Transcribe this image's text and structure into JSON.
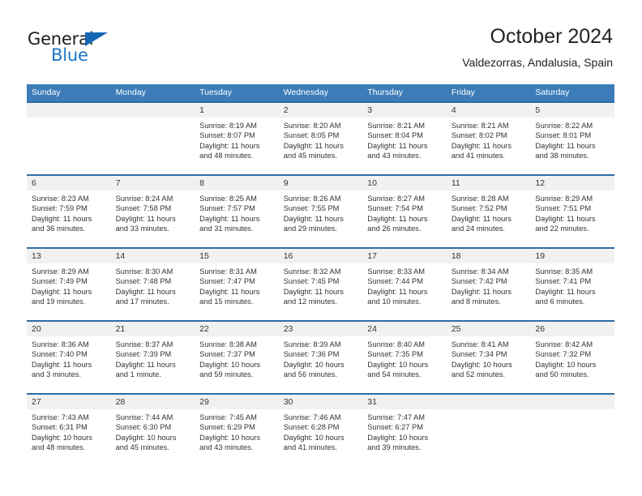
{
  "brand": {
    "name_part1": "General",
    "name_part2": "Blue",
    "triangle_color": "#1567b2",
    "blue_color": "#1b76c4"
  },
  "header": {
    "title": "October 2024",
    "subtitle": "Valdezorras, Andalusia, Spain"
  },
  "theme": {
    "header_bg": "#3c7cb8",
    "row_rule": "#2e6da4",
    "daynum_bg": "#f1f1f1"
  },
  "weekdays": [
    "Sunday",
    "Monday",
    "Tuesday",
    "Wednesday",
    "Thursday",
    "Friday",
    "Saturday"
  ],
  "weeks": [
    [
      {
        "day": "",
        "sunrise": "",
        "sunset": "",
        "daylight_line1": "",
        "daylight_line2": ""
      },
      {
        "day": "",
        "sunrise": "",
        "sunset": "",
        "daylight_line1": "",
        "daylight_line2": ""
      },
      {
        "day": "1",
        "sunrise": "Sunrise: 8:19 AM",
        "sunset": "Sunset: 8:07 PM",
        "daylight_line1": "Daylight: 11 hours",
        "daylight_line2": "and 48 minutes."
      },
      {
        "day": "2",
        "sunrise": "Sunrise: 8:20 AM",
        "sunset": "Sunset: 8:05 PM",
        "daylight_line1": "Daylight: 11 hours",
        "daylight_line2": "and 45 minutes."
      },
      {
        "day": "3",
        "sunrise": "Sunrise: 8:21 AM",
        "sunset": "Sunset: 8:04 PM",
        "daylight_line1": "Daylight: 11 hours",
        "daylight_line2": "and 43 minutes."
      },
      {
        "day": "4",
        "sunrise": "Sunrise: 8:21 AM",
        "sunset": "Sunset: 8:02 PM",
        "daylight_line1": "Daylight: 11 hours",
        "daylight_line2": "and 41 minutes."
      },
      {
        "day": "5",
        "sunrise": "Sunrise: 8:22 AM",
        "sunset": "Sunset: 8:01 PM",
        "daylight_line1": "Daylight: 11 hours",
        "daylight_line2": "and 38 minutes."
      }
    ],
    [
      {
        "day": "6",
        "sunrise": "Sunrise: 8:23 AM",
        "sunset": "Sunset: 7:59 PM",
        "daylight_line1": "Daylight: 11 hours",
        "daylight_line2": "and 36 minutes."
      },
      {
        "day": "7",
        "sunrise": "Sunrise: 8:24 AM",
        "sunset": "Sunset: 7:58 PM",
        "daylight_line1": "Daylight: 11 hours",
        "daylight_line2": "and 33 minutes."
      },
      {
        "day": "8",
        "sunrise": "Sunrise: 8:25 AM",
        "sunset": "Sunset: 7:57 PM",
        "daylight_line1": "Daylight: 11 hours",
        "daylight_line2": "and 31 minutes."
      },
      {
        "day": "9",
        "sunrise": "Sunrise: 8:26 AM",
        "sunset": "Sunset: 7:55 PM",
        "daylight_line1": "Daylight: 11 hours",
        "daylight_line2": "and 29 minutes."
      },
      {
        "day": "10",
        "sunrise": "Sunrise: 8:27 AM",
        "sunset": "Sunset: 7:54 PM",
        "daylight_line1": "Daylight: 11 hours",
        "daylight_line2": "and 26 minutes."
      },
      {
        "day": "11",
        "sunrise": "Sunrise: 8:28 AM",
        "sunset": "Sunset: 7:52 PM",
        "daylight_line1": "Daylight: 11 hours",
        "daylight_line2": "and 24 minutes."
      },
      {
        "day": "12",
        "sunrise": "Sunrise: 8:29 AM",
        "sunset": "Sunset: 7:51 PM",
        "daylight_line1": "Daylight: 11 hours",
        "daylight_line2": "and 22 minutes."
      }
    ],
    [
      {
        "day": "13",
        "sunrise": "Sunrise: 8:29 AM",
        "sunset": "Sunset: 7:49 PM",
        "daylight_line1": "Daylight: 11 hours",
        "daylight_line2": "and 19 minutes."
      },
      {
        "day": "14",
        "sunrise": "Sunrise: 8:30 AM",
        "sunset": "Sunset: 7:48 PM",
        "daylight_line1": "Daylight: 11 hours",
        "daylight_line2": "and 17 minutes."
      },
      {
        "day": "15",
        "sunrise": "Sunrise: 8:31 AM",
        "sunset": "Sunset: 7:47 PM",
        "daylight_line1": "Daylight: 11 hours",
        "daylight_line2": "and 15 minutes."
      },
      {
        "day": "16",
        "sunrise": "Sunrise: 8:32 AM",
        "sunset": "Sunset: 7:45 PM",
        "daylight_line1": "Daylight: 11 hours",
        "daylight_line2": "and 12 minutes."
      },
      {
        "day": "17",
        "sunrise": "Sunrise: 8:33 AM",
        "sunset": "Sunset: 7:44 PM",
        "daylight_line1": "Daylight: 11 hours",
        "daylight_line2": "and 10 minutes."
      },
      {
        "day": "18",
        "sunrise": "Sunrise: 8:34 AM",
        "sunset": "Sunset: 7:42 PM",
        "daylight_line1": "Daylight: 11 hours",
        "daylight_line2": "and 8 minutes."
      },
      {
        "day": "19",
        "sunrise": "Sunrise: 8:35 AM",
        "sunset": "Sunset: 7:41 PM",
        "daylight_line1": "Daylight: 11 hours",
        "daylight_line2": "and 6 minutes."
      }
    ],
    [
      {
        "day": "20",
        "sunrise": "Sunrise: 8:36 AM",
        "sunset": "Sunset: 7:40 PM",
        "daylight_line1": "Daylight: 11 hours",
        "daylight_line2": "and 3 minutes."
      },
      {
        "day": "21",
        "sunrise": "Sunrise: 8:37 AM",
        "sunset": "Sunset: 7:39 PM",
        "daylight_line1": "Daylight: 11 hours",
        "daylight_line2": "and 1 minute."
      },
      {
        "day": "22",
        "sunrise": "Sunrise: 8:38 AM",
        "sunset": "Sunset: 7:37 PM",
        "daylight_line1": "Daylight: 10 hours",
        "daylight_line2": "and 59 minutes."
      },
      {
        "day": "23",
        "sunrise": "Sunrise: 8:39 AM",
        "sunset": "Sunset: 7:36 PM",
        "daylight_line1": "Daylight: 10 hours",
        "daylight_line2": "and 56 minutes."
      },
      {
        "day": "24",
        "sunrise": "Sunrise: 8:40 AM",
        "sunset": "Sunset: 7:35 PM",
        "daylight_line1": "Daylight: 10 hours",
        "daylight_line2": "and 54 minutes."
      },
      {
        "day": "25",
        "sunrise": "Sunrise: 8:41 AM",
        "sunset": "Sunset: 7:34 PM",
        "daylight_line1": "Daylight: 10 hours",
        "daylight_line2": "and 52 minutes."
      },
      {
        "day": "26",
        "sunrise": "Sunrise: 8:42 AM",
        "sunset": "Sunset: 7:32 PM",
        "daylight_line1": "Daylight: 10 hours",
        "daylight_line2": "and 50 minutes."
      }
    ],
    [
      {
        "day": "27",
        "sunrise": "Sunrise: 7:43 AM",
        "sunset": "Sunset: 6:31 PM",
        "daylight_line1": "Daylight: 10 hours",
        "daylight_line2": "and 48 minutes."
      },
      {
        "day": "28",
        "sunrise": "Sunrise: 7:44 AM",
        "sunset": "Sunset: 6:30 PM",
        "daylight_line1": "Daylight: 10 hours",
        "daylight_line2": "and 45 minutes."
      },
      {
        "day": "29",
        "sunrise": "Sunrise: 7:45 AM",
        "sunset": "Sunset: 6:29 PM",
        "daylight_line1": "Daylight: 10 hours",
        "daylight_line2": "and 43 minutes."
      },
      {
        "day": "30",
        "sunrise": "Sunrise: 7:46 AM",
        "sunset": "Sunset: 6:28 PM",
        "daylight_line1": "Daylight: 10 hours",
        "daylight_line2": "and 41 minutes."
      },
      {
        "day": "31",
        "sunrise": "Sunrise: 7:47 AM",
        "sunset": "Sunset: 6:27 PM",
        "daylight_line1": "Daylight: 10 hours",
        "daylight_line2": "and 39 minutes."
      },
      {
        "day": "",
        "sunrise": "",
        "sunset": "",
        "daylight_line1": "",
        "daylight_line2": ""
      },
      {
        "day": "",
        "sunrise": "",
        "sunset": "",
        "daylight_line1": "",
        "daylight_line2": ""
      }
    ]
  ]
}
